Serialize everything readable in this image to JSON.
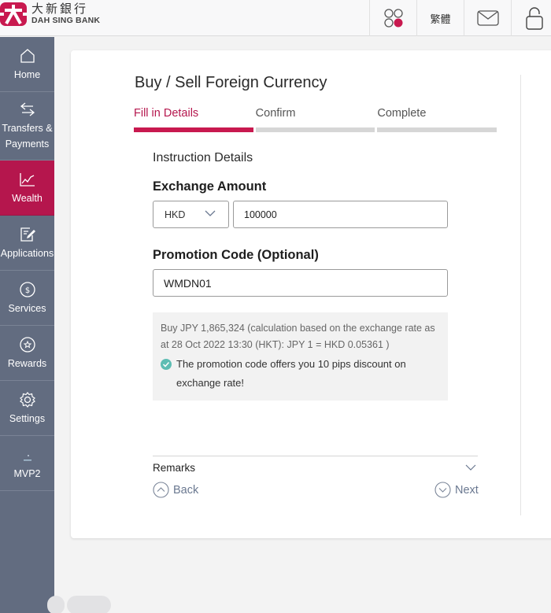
{
  "header": {
    "bank_name_cn": "大新銀行",
    "bank_name_en": "DAH SING BANK",
    "language_toggle": "繁體",
    "icons": [
      "apps-icon",
      "mail-icon",
      "lock-icon"
    ],
    "brand_color": "#c8194f"
  },
  "sidebar": {
    "items": [
      {
        "label": "Home",
        "icon": "home-icon",
        "active": false
      },
      {
        "label": "Transfers & Payments",
        "icon": "transfer-icon",
        "active": false
      },
      {
        "label": "Wealth",
        "icon": "chart-icon",
        "active": true
      },
      {
        "label": "Applications",
        "icon": "edit-icon",
        "active": false
      },
      {
        "label": "Services",
        "icon": "dollar-icon",
        "active": false
      },
      {
        "label": "Rewards",
        "icon": "star-icon",
        "active": false
      },
      {
        "label": "Settings",
        "icon": "gear-icon",
        "active": false
      },
      {
        "label": "MVP2",
        "icon": "mvp-icon",
        "active": false
      }
    ]
  },
  "main": {
    "title": "Buy / Sell Foreign Currency",
    "steps": [
      {
        "label": "Fill in Details",
        "active": true
      },
      {
        "label": "Confirm",
        "active": false
      },
      {
        "label": "Complete",
        "active": false
      }
    ],
    "section_title": "Instruction Details",
    "exchange_amount": {
      "label": "Exchange Amount",
      "currency": "HKD",
      "amount": "100000"
    },
    "promotion": {
      "label": "Promotion Code (Optional)",
      "code": "WMDN01"
    },
    "info": {
      "calculation": "Buy JPY 1,865,324 (calculation based on the exchange rate as at 28 Oct 2022 13:30 (HKT): JPY 1 = HKD 0.05361 )",
      "promo_message": "The promotion code offers you 10 pips discount on exchange rate!"
    },
    "remarks_label": "Remarks",
    "back_label": "Back",
    "next_label": "Next"
  }
}
